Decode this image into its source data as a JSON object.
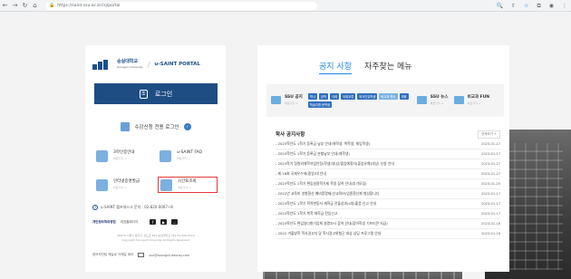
{
  "browser": {
    "url": "https://saint.ssu.ac.kr/irj/portal"
  },
  "left": {
    "university_name": "숭실대학교",
    "university_sub": "Soongsil University",
    "portal_name": "u-SAINT PORTAL",
    "login_label": "로그인",
    "course_login_label": "수강신청 전용 로그인",
    "quick_items": [
      {
        "label": "3학인증안내",
        "sub": "바로가기 →"
      },
      {
        "label": "u-SAINT FAQ",
        "sub": "바로가기 →"
      },
      {
        "label": "인터넷증명발급",
        "sub": "바로가기 →"
      },
      {
        "label": "시간표조회",
        "sub": "바로가기 →"
      }
    ],
    "helpdesk": "u-SAINT 헬프데스크 문의 : 02-820-0067~8",
    "privacy": "개인정보처리방침",
    "homepage": "대표홈페이지",
    "address_line1": "06978 서울시 동작구 상도로 369 숭실대학교 TEL 02-820-0114",
    "address_line2": "Copyright Soongsil University All Rights Reserved.",
    "security_label": "정보보안팀 메일로 이메일 제보",
    "email": "ssu@soongsil.daoray.com"
  },
  "right": {
    "tab_active": "공지 사항",
    "tab_inactive": "자주찾는 메뉴",
    "categories": {
      "ssu_notice": {
        "label": "SSU 공지",
        "sub": "바로가기 →"
      },
      "ssu_news": {
        "label": "SSU 뉴스",
        "sub": "바로가기 →"
      },
      "fun": {
        "label": "비교과 FUN",
        "sub": "바로가기 →"
      }
    },
    "chips": [
      "학사",
      "장학",
      "국제",
      "국제교류",
      "외국인유학생",
      "비교과·행사",
      "채용",
      "학술지원·문학생"
    ],
    "notice_header": "학사 공지사항",
    "more_label": "전체보기 +",
    "notices": [
      {
        "title": "- 2023학년도 1학기 등록금 납부 안내(재학생, 복학생, 재입학생)",
        "date": "2023-01-27"
      },
      {
        "title": "- 2023학년도 1학기 등록금 분할납부 안내(재학생)",
        "date": "2023-01-27"
      },
      {
        "title": "- 2023학기 정원외재학자업안정(학생(대)상/졸업예정자(졸업유예)대상) 신청 안내",
        "date": "2023-01-27"
      },
      {
        "title": "- 제 16회 국제우수에(중앙)대 안내",
        "date": "2023-01-27"
      },
      {
        "title": "- 2023학년도 1학기 편입실용학기제 학생 참여 안내(추가모집)",
        "date": "2023-01-20"
      },
      {
        "title": "- 2022년 교육비 영향환산 예비증명제(산교육비)업종환산제 형성합니다",
        "date": "2023-01-17"
      },
      {
        "title": "- 2023학년도 1학기 학적변동자 재학급 전출성과(4대)출증 신고 안내",
        "date": "2023-01-17"
      },
      {
        "title": "- 2023학년도 1학기 복학 재학급 전입신고",
        "date": "2023-01-17"
      },
      {
        "title": "- 2023학년도 편입일다향기업체 설명조사 참여 안내(참여학생 기프티콘 지급)",
        "date": "2023-01-16"
      },
      {
        "title": "- 2022 겨울방학 학사경고자 및 학사경고위험군 대상 상담 프로그램 안내",
        "date": "2023-01-16"
      }
    ]
  }
}
